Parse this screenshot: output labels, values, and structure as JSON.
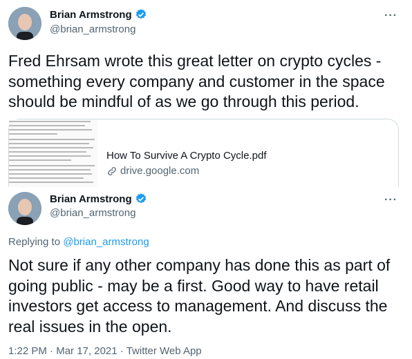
{
  "tweets": [
    {
      "author": {
        "name": "Brian Armstrong",
        "handle": "@brian_armstrong",
        "verified": true
      },
      "more_icon": "more-horizontal-icon",
      "text_lines": [
        "Fred Ehrsam wrote this great letter on crypto cycles -",
        "something every company and customer in the space",
        "should be mindful of as we go through this period."
      ],
      "card": {
        "title": "How To Survive A Crypto Cycle.pdf",
        "domain": "drive.google.com",
        "icon": "link-icon"
      }
    },
    {
      "author": {
        "name": "Brian Armstrong",
        "handle": "@brian_armstrong",
        "verified": true
      },
      "more_icon": "more-horizontal-icon",
      "replying_label": "Replying to",
      "replying_handle": "@brian_armstrong",
      "text_lines": [
        "Not sure if any other company has done this as part of",
        "going public - may be a first. Good way to have retail",
        "investors get access to management. And discuss the",
        "real issues in the open."
      ],
      "time": "1:22 PM",
      "date": "Mar 17, 2021",
      "source": "Twitter Web App",
      "separator": "·"
    }
  ],
  "colors": {
    "text": "#0f1419",
    "secondary": "#536471",
    "accent": "#1d9bf0",
    "border": "#cfd9de"
  }
}
